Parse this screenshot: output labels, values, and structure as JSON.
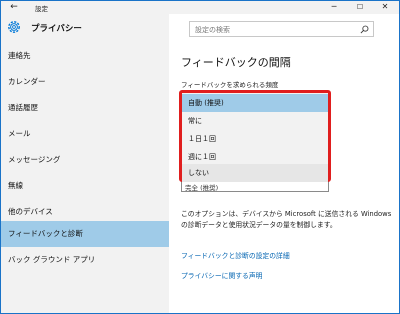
{
  "titlebar": {
    "title": "設定",
    "back_glyph": "←",
    "min_glyph": "─",
    "max_glyph": "☐",
    "close_glyph": "✕"
  },
  "sidebar": {
    "title": "プライバシー",
    "items": [
      {
        "label": "連絡先"
      },
      {
        "label": "カレンダー"
      },
      {
        "label": "通話履歴"
      },
      {
        "label": "メール"
      },
      {
        "label": "メッセージング"
      },
      {
        "label": "無線"
      },
      {
        "label": "他のデバイス"
      },
      {
        "label": "フィードバックと診断",
        "selected": true
      },
      {
        "label": "バック グラウンド アプリ"
      }
    ]
  },
  "search": {
    "placeholder": "設定の検索"
  },
  "main": {
    "title": "フィードバックの間隔",
    "freq_label": "フィードバックを求められる頻度",
    "partial_select_value": "完全 (推奨)",
    "description": "このオプションは、デバイスから Microsoft に送信される Windows の診断データと使用状況データの量を制御します。",
    "links": [
      {
        "label": "フィードバックと診断の設定の詳細"
      },
      {
        "label": "プライバシーに関する声明"
      }
    ]
  },
  "dropdown": {
    "options": [
      "自動 (推奨)",
      "常に",
      "１日１回",
      "週に１回",
      "しない"
    ],
    "selected_index": 0
  },
  "colors": {
    "accent": "#0063b1",
    "highlight": "#9fcbe8",
    "annotation": "#e01e1e",
    "sidebar_bg": "#f2f2f2"
  }
}
